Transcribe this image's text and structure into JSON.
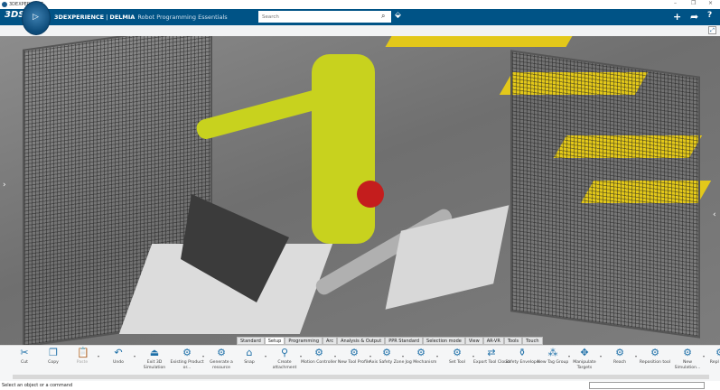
{
  "window": {
    "title": "3DEXPERIENCE",
    "minimize": "–",
    "restore": "❐",
    "close": "×"
  },
  "header": {
    "brand": "3DEXPERIENCE",
    "separator": " | ",
    "product": "DELMIA",
    "app": "Robot Programming Essentials",
    "search_placeholder": "Search",
    "compass_label": "▷",
    "color": "#005386"
  },
  "tabs": [
    {
      "label": "Standard",
      "active": false
    },
    {
      "label": "Setup",
      "active": true
    },
    {
      "label": "Programming"
    },
    {
      "label": "Arc"
    },
    {
      "label": "Analysis & Output"
    },
    {
      "label": "PPR Standard"
    },
    {
      "label": "Selection mode"
    },
    {
      "label": "View"
    },
    {
      "label": "AR-VR"
    },
    {
      "label": "Tools"
    },
    {
      "label": "Touch"
    }
  ],
  "toolbar": [
    {
      "label": "Cut",
      "icon": "scissors-icon",
      "glyph": "✂"
    },
    {
      "label": "Copy",
      "icon": "copy-icon",
      "glyph": "❐"
    },
    {
      "label": "Paste",
      "icon": "paste-icon",
      "glyph": "📋",
      "disabled": true,
      "dropdown": true
    },
    {
      "label": "Undo",
      "icon": "undo-icon",
      "glyph": "↶",
      "dropdown": true
    },
    {
      "label": "Exit 3D Simulation",
      "icon": "exit-simulation-icon",
      "glyph": "⏏"
    },
    {
      "label": "Existing Product or...",
      "icon": "existing-product-icon",
      "glyph": "⚙",
      "dropdown": true
    },
    {
      "label": "Generate a resource",
      "icon": "generate-resource-icon",
      "glyph": "⚙"
    },
    {
      "label": "Snap",
      "icon": "snap-icon",
      "glyph": "⌂",
      "dropdown": true
    },
    {
      "label": "Create attachment",
      "icon": "attachment-icon",
      "glyph": "⚲",
      "dropdown": true
    },
    {
      "label": "Motion Controller",
      "icon": "motion-controller-icon",
      "glyph": "⚙",
      "dropdown": true
    },
    {
      "label": "New Tool Profile",
      "icon": "tool-profile-icon",
      "glyph": "⚙",
      "dropdown": true
    },
    {
      "label": "Axis Safety Zone",
      "icon": "safety-zone-icon",
      "glyph": "⚙",
      "dropdown": true
    },
    {
      "label": "Jog Mechanism",
      "icon": "jog-icon",
      "glyph": "⚙",
      "dropdown": true
    },
    {
      "label": "Set Tool",
      "icon": "set-tool-icon",
      "glyph": "⚙",
      "dropdown": true
    },
    {
      "label": "Export Tool Cloud",
      "icon": "export-cloud-icon",
      "glyph": "⇄"
    },
    {
      "label": "Safety Envelope",
      "icon": "safety-envelope-icon",
      "glyph": "⚱"
    },
    {
      "label": "New Tag Group",
      "icon": "tag-group-icon",
      "glyph": "⁂",
      "dropdown": true
    },
    {
      "label": "Manipulate Targets",
      "icon": "targets-icon",
      "glyph": "✥",
      "dropdown": true
    },
    {
      "label": "Reach",
      "icon": "reach-icon",
      "glyph": "⚙",
      "dropdown": true
    },
    {
      "label": "Reposition tool",
      "icon": "reposition-icon",
      "glyph": "⚙"
    },
    {
      "label": "New Simulation...",
      "icon": "simulation-icon",
      "glyph": "⚙",
      "dropdown": true
    },
    {
      "label": "Repl Traje",
      "icon": "replay-trajectory-icon",
      "glyph": "⚙"
    }
  ],
  "status": {
    "message": "Select an object or a command"
  }
}
